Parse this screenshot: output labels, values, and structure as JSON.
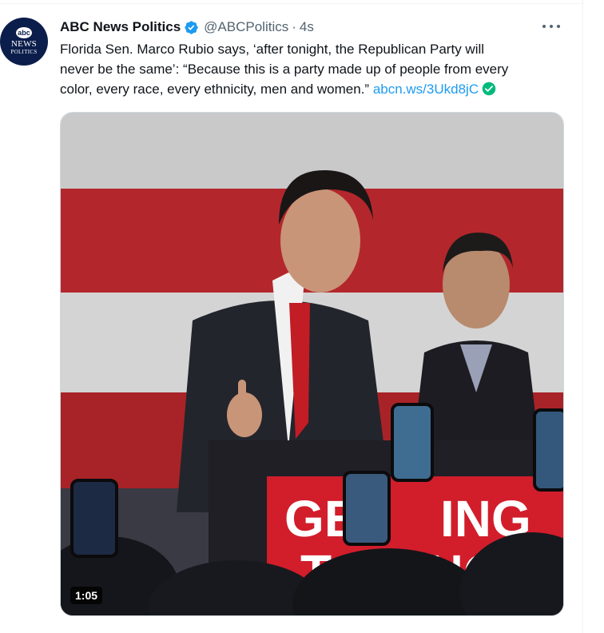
{
  "account": {
    "display_name": "ABC News Politics",
    "handle": "@ABCPolitics",
    "separator": "·",
    "time": "4s",
    "avatar_text_top": "abc",
    "avatar_text_mid": "NEWS",
    "avatar_text_bot": "POLITICS"
  },
  "tweet": {
    "text_line1": "Florida Sen. Marco Rubio says, ‘after tonight, the Republican Party will",
    "text_line2": "never be the same’: “Because this is a party made up of people from every",
    "text_line3": "color, every race, every ethnicity, men and women.”",
    "link_text": "abcn.ws/3Ukd8jC"
  },
  "media": {
    "duration": "1:05",
    "sign_text_1": "GE",
    "sign_text_2": "ING",
    "sign_text_3": "T",
    "sign_text_4": "INGS"
  },
  "colors": {
    "link": "#1d9bf0",
    "verified": "#1d9bf0",
    "check": "#00ba7c",
    "text": "#0f1419",
    "muted": "#536471"
  },
  "icons": [
    "verified-badge-icon",
    "more-options-icon",
    "check-circle-icon"
  ]
}
